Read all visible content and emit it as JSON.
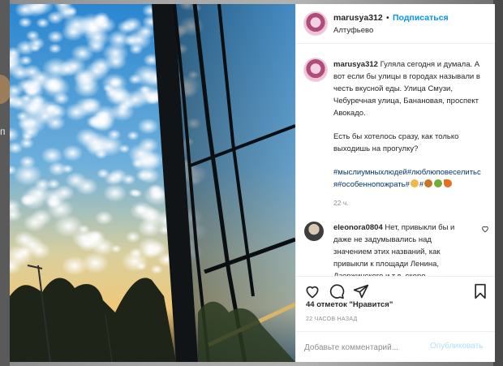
{
  "post": {
    "username": "marusya312",
    "separator": "•",
    "follow_label": "Подписаться",
    "location": "Алтуфьево"
  },
  "caption": {
    "username": "marusya312",
    "line1": "Гуляла сегодня и думала. А вот если бы улицы в городах называли в честь вкусной еды. Улица Смузи, Чебуречная улица, Банановая, проспект Авокадо.",
    "line2": "Есть бы хотелось сразу, как только выходишь на прогулку?",
    "hashtags": "#мыслиумныхлюдей#люблюповеселиться#особеннопожрать#",
    "hashtag2": "#",
    "time": "22 ч."
  },
  "comment": {
    "username": "eleonora0804",
    "text": "Нет, привыкли бы и даже не задумывались над значением этих названий, как привыкли к площади Ленина, Дзержинского и т.д. скоро"
  },
  "actions": {
    "likes": "44 отметок \"Нравится\"",
    "time": "22 ЧАСОВ НАЗАД"
  },
  "add_comment": {
    "placeholder": "Добавьте комментарий...",
    "post_label": "Опубликовать"
  },
  "backdrop": {
    "peek_letter": "п"
  },
  "icons": [
    "heart-icon",
    "comment-icon",
    "share-icon",
    "bookmark-icon"
  ],
  "colors": {
    "link": "#0095f6",
    "hashtag": "#00376b",
    "muted": "#8e8e8e",
    "text": "#262626",
    "sky": "#2f8fd6"
  }
}
